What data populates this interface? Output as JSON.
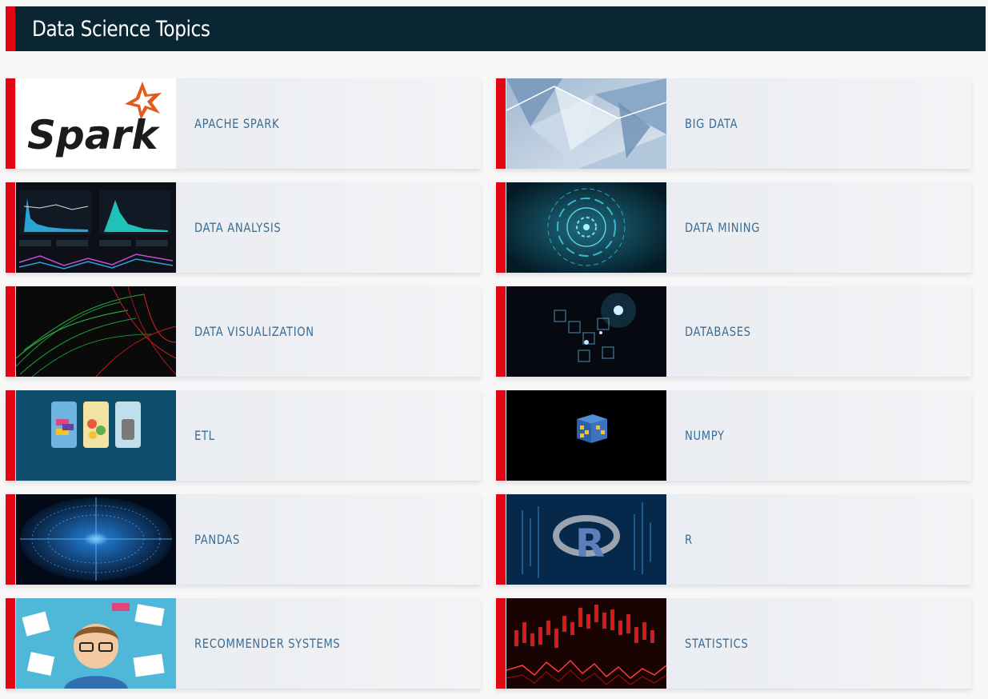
{
  "header": {
    "title": "Data Science Topics"
  },
  "topics": [
    {
      "label": "APACHE SPARK",
      "thumb_text": "Spark"
    },
    {
      "label": "BIG DATA"
    },
    {
      "label": "DATA ANALYSIS"
    },
    {
      "label": "DATA MINING"
    },
    {
      "label": "DATA VISUALIZATION"
    },
    {
      "label": "DATABASES"
    },
    {
      "label": "ETL"
    },
    {
      "label": "NUMPY"
    },
    {
      "label": "PANDAS"
    },
    {
      "label": "R",
      "thumb_text": "R"
    },
    {
      "label": "RECOMMENDER SYSTEMS"
    },
    {
      "label": "STATISTICS"
    }
  ],
  "colors": {
    "header_bg": "#0b2633",
    "accent_red": "#e10613",
    "label_blue": "#3a6d96",
    "card_bg": "#e4e8ee"
  }
}
